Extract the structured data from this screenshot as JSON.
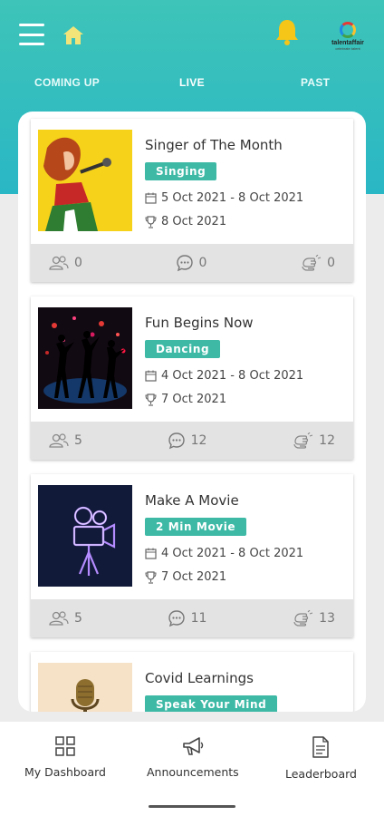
{
  "header": {
    "menu_icon": "hamburger-menu-icon",
    "home_icon": "home-icon",
    "bell_icon": "bell-icon",
    "brand": {
      "name": "talentaffair",
      "tagline": "celebrate talent",
      "icon": "brand-logo"
    },
    "accent_colors": {
      "header": "#3ec4b8",
      "tag": "#3db9a6",
      "bell": "#f5c518"
    }
  },
  "tabs": [
    {
      "label": "COMING UP",
      "active": false
    },
    {
      "label": "LIVE",
      "active": true
    },
    {
      "label": "PAST",
      "active": false
    }
  ],
  "contests": [
    {
      "title": "Singer of The Month",
      "tag": "Singing",
      "dates": "5 Oct 2021 - 8 Oct 2021",
      "result_date": "8 Oct 2021",
      "participants": "0",
      "comments": "0",
      "votes": "0",
      "image": "singer-illustration"
    },
    {
      "title": "Fun Begins Now",
      "tag": "Dancing",
      "dates": "4 Oct 2021 - 8 Oct 2021",
      "result_date": "7 Oct 2021",
      "participants": "5",
      "comments": "12",
      "votes": "12",
      "image": "dancers-silhouette"
    },
    {
      "title": "Make A Movie",
      "tag": "2 Min Movie",
      "dates": "4 Oct 2021 - 8 Oct 2021",
      "result_date": "7 Oct 2021",
      "participants": "5",
      "comments": "11",
      "votes": "13",
      "image": "neon-movie-camera"
    },
    {
      "title": "Covid Learnings",
      "tag": "Speak Your Mind",
      "image": "microphone-illustration"
    }
  ],
  "bottom_nav": [
    {
      "label": "My Dashboard",
      "icon": "dashboard-grid-icon"
    },
    {
      "label": "Announcements",
      "icon": "megaphone-icon"
    },
    {
      "label": "Leaderboard",
      "icon": "document-icon"
    }
  ]
}
